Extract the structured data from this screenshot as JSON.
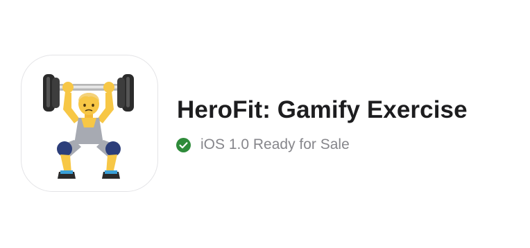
{
  "app": {
    "icon": "weightlifter-emoji-icon",
    "name": "HeroFit: Gamify Exercise"
  },
  "status": {
    "icon": "check-circle-icon",
    "color": "#2e8b3a",
    "text": "iOS 1.0 Ready for Sale"
  }
}
